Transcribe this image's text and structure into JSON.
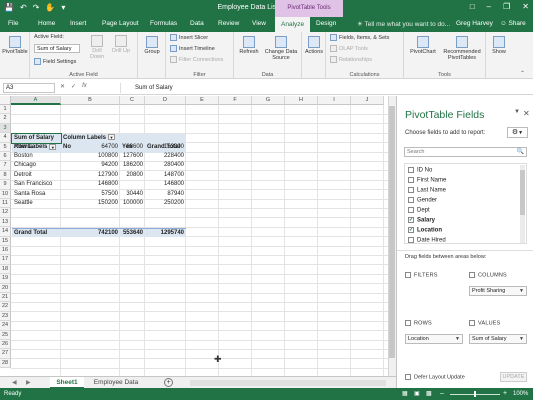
{
  "window": {
    "title": "Employee Data List.xlsx - Excel",
    "contextual_tab_group": "PivotTable Tools",
    "qat_icons": [
      "save-icon",
      "undo-icon",
      "redo-icon",
      "touch-mode-icon",
      "customize-qat-icon"
    ],
    "window_buttons": [
      "ribbon-display-icon",
      "minimize-icon",
      "restore-icon",
      "close-icon"
    ]
  },
  "tabs": [
    {
      "label": "File"
    },
    {
      "label": "Home"
    },
    {
      "label": "Insert"
    },
    {
      "label": "Page Layout"
    },
    {
      "label": "Formulas"
    },
    {
      "label": "Data"
    },
    {
      "label": "Review"
    },
    {
      "label": "View"
    },
    {
      "label": "Analyze"
    },
    {
      "label": "Design"
    }
  ],
  "tell_me": "Tell me what you want to do...",
  "user": "Greg Harvey",
  "share": "Share",
  "ribbon": {
    "pivottable": "PivotTable",
    "active_field_label": "Active Field:",
    "active_field_value": "Sum of Salary",
    "field_settings": "Field Settings",
    "drill_down": "Drill Down",
    "drill_up": "Drill Up",
    "active_field_group": "Active Field",
    "group": "Group",
    "insert_slicer": "Insert Slicer",
    "insert_timeline": "Insert Timeline",
    "filter_connections": "Filter Connections",
    "filter_group": "Filter",
    "refresh": "Refresh",
    "change_data_source": "Change Data Source",
    "data_group": "Data",
    "actions": "Actions",
    "fields_items_sets": "Fields, Items, & Sets",
    "olap_tools": "OLAP Tools",
    "relationships": "Relationships",
    "calculations_group": "Calculations",
    "pivotchart": "PivotChart",
    "recommended_pivottables": "Recommended PivotTables",
    "tools_group": "Tools",
    "show": "Show"
  },
  "formula_bar": {
    "name_box": "A3",
    "formula": "Sum of Salary"
  },
  "sheet": {
    "columns": [
      "A",
      "B",
      "C",
      "D",
      "E",
      "F",
      "G",
      "H",
      "I",
      "J"
    ],
    "rows": [
      "1",
      "2",
      "3",
      "4",
      "5",
      "6",
      "7",
      "8",
      "9",
      "10",
      "11",
      "12",
      "13",
      "14",
      "15",
      "16",
      "17",
      "18",
      "19",
      "20",
      "21",
      "22",
      "23",
      "24",
      "25",
      "26",
      "27",
      "28"
    ],
    "pivot": {
      "corner": "Sum of Salary",
      "col_labels": "Column Labels",
      "row_labels": "Row Labels",
      "headers": [
        "No",
        "Yes",
        "Grand Total"
      ],
      "rows": [
        {
          "label": "Atlanta",
          "no": "64700",
          "yes": "88600",
          "total": "153300"
        },
        {
          "label": "Boston",
          "no": "100800",
          "yes": "127600",
          "total": "228400"
        },
        {
          "label": "Chicago",
          "no": "94200",
          "yes": "186200",
          "total": "280400"
        },
        {
          "label": "Detroit",
          "no": "127900",
          "yes": "20800",
          "total": "148700"
        },
        {
          "label": "San Francisco",
          "no": "146800",
          "yes": "",
          "total": "146800"
        },
        {
          "label": "Santa Rosa",
          "no": "57500",
          "yes": "30440",
          "total": "87940"
        },
        {
          "label": "Seattle",
          "no": "150200",
          "yes": "100000",
          "total": "250200"
        }
      ],
      "grand_total": {
        "label": "Grand Total",
        "no": "742100",
        "yes": "553640",
        "total": "1295740"
      }
    },
    "tabs": [
      "Sheet1",
      "Employee Data"
    ]
  },
  "status": {
    "ready": "Ready",
    "zoom": "100%"
  },
  "pane": {
    "title": "PivotTable Fields",
    "choose": "Choose fields to add to report:",
    "search_placeholder": "Search",
    "fields": [
      {
        "name": "ID No",
        "checked": false
      },
      {
        "name": "First Name",
        "checked": false
      },
      {
        "name": "Last Name",
        "checked": false
      },
      {
        "name": "Gender",
        "checked": false
      },
      {
        "name": "Dept",
        "checked": false
      },
      {
        "name": "Salary",
        "checked": true
      },
      {
        "name": "Location",
        "checked": true
      },
      {
        "name": "Date Hired",
        "checked": false
      }
    ],
    "drag_text": "Drag fields between areas below:",
    "filters": "FILTERS",
    "columns": "COLUMNS",
    "rows": "ROWS",
    "values": "VALUES",
    "columns_field": "Profit Sharing",
    "rows_field": "Location",
    "values_field": "Sum of Salary",
    "defer": "Defer Layout Update",
    "update": "UPDATE"
  }
}
